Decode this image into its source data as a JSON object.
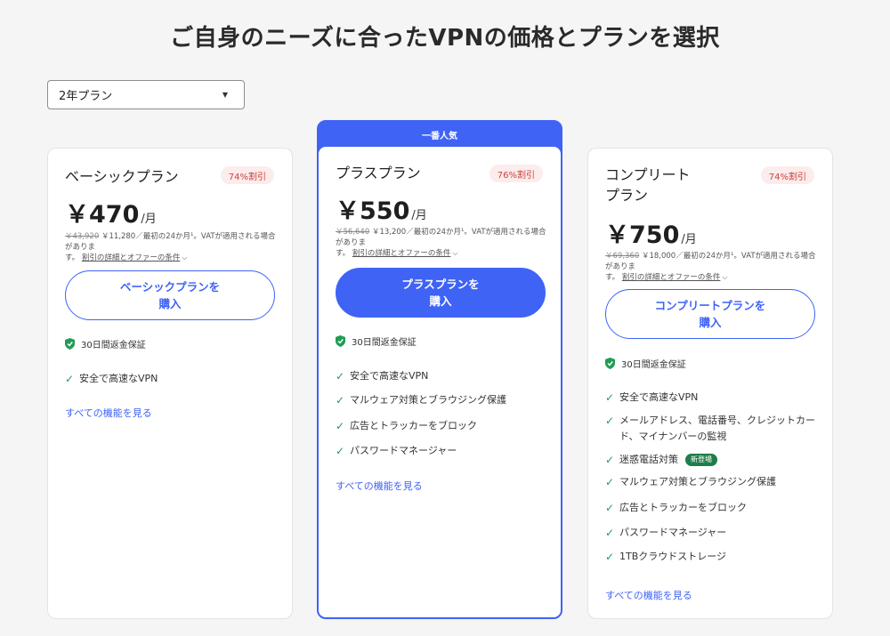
{
  "page": {
    "title": "ご自身のニーズに合ったVPNの価格とプランを選択"
  },
  "period_select": {
    "selected": "2年プラン"
  },
  "plans": [
    {
      "name": "ベーシックプラン",
      "discount": "74%割引",
      "price": "￥470",
      "unit": "/月",
      "original_price": "￥43,920",
      "fine_print_main": " ￥11,280／最初の24か月¹。VATが適用される場合がありま",
      "fine_print_end": "す。",
      "terms_link": "割引の詳細とオファーの条件",
      "buy_label_line1": "ベーシックプランを",
      "buy_label_line2": "購入",
      "guarantee": "30日間返金保証",
      "features": [
        "安全で高速なVPN"
      ],
      "see_all": "すべての機能を見る"
    },
    {
      "ribbon": "一番人気",
      "name": "プラスプラン",
      "discount": "76%割引",
      "price": "￥550",
      "unit": "/月",
      "original_price": "￥56,640",
      "fine_print_main": " ￥13,200／最初の24か月¹。VATが適用される場合がありま",
      "fine_print_end": "す。",
      "terms_link": "割引の詳細とオファーの条件",
      "buy_label_line1": "プラスプランを",
      "buy_label_line2": "購入",
      "guarantee": "30日間返金保証",
      "features": [
        "安全で高速なVPN",
        "マルウェア対策とブラウジング保護",
        "広告とトラッカーをブロック",
        "パスワードマネージャー"
      ],
      "see_all": "すべての機能を見る"
    },
    {
      "name_line1": "コンプリート",
      "name_line2": "プラン",
      "discount": "74%割引",
      "price": "￥750",
      "unit": "/月",
      "original_price": "￥69,360",
      "fine_print_main": " ￥18,000／最初の24か月¹。VATが適用される場合がありま",
      "fine_print_end": "す。",
      "terms_link": "割引の詳細とオファーの条件",
      "buy_label_line1": "コンプリートプランを",
      "buy_label_line2": "購入",
      "guarantee": "30日間返金保証",
      "features": [
        "安全で高速なVPN",
        "メールアドレス、電話番号、クレジットカード、マイナンバーの監視",
        "迷惑電話対策",
        "マルウェア対策とブラウジング保護",
        "広告とトラッカーをブロック",
        "パスワードマネージャー",
        "1TBクラウドストレージ"
      ],
      "new_badge": "新登場",
      "see_all": "すべての機能を見る"
    }
  ],
  "colors": {
    "accent": "#3f63f5",
    "check": "#1f9d55",
    "discount_bg": "#fdecec",
    "discount_text": "#c9443f",
    "new_badge_bg": "#1f7d4a"
  },
  "icons": {
    "guarantee": "shield-check-icon",
    "feature": "check-icon",
    "select_caret": "caret-down-icon",
    "terms_chevron": "chevron-down-icon"
  }
}
